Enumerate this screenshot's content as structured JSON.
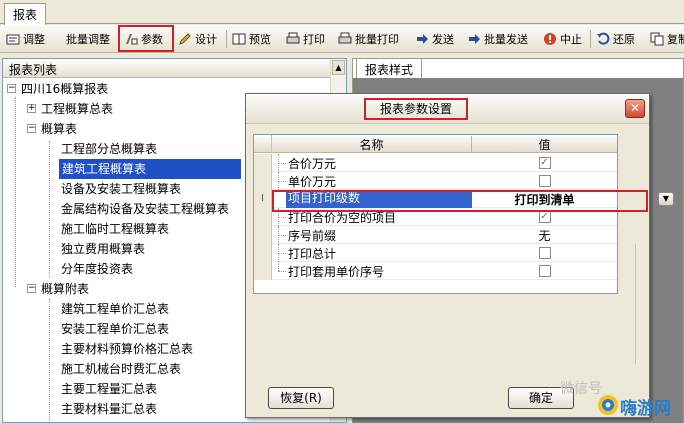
{
  "tab": {
    "label": "报表"
  },
  "toolbar": {
    "adjust": "调整",
    "batch_adjust": "批量调整",
    "params": "参数",
    "design": "设计",
    "preview": "预览",
    "print": "打印",
    "batch_print": "批量打印",
    "send": "发送",
    "batch_send": "批量发送",
    "abort": "中止",
    "restore": "还原",
    "copy": "复制"
  },
  "tree": {
    "header": "报表列表",
    "root": "四川16概算报表",
    "items": [
      "工程概算总表",
      "概算表",
      "工程部分总概算表",
      "建筑工程概算表",
      "设备及安装工程概算表",
      "金属结构设备及安装工程概算表",
      "施工临时工程概算表",
      "独立费用概算表",
      "分年度投资表",
      "概算附表",
      "建筑工程单价汇总表",
      "安装工程单价汇总表",
      "主要材料预算价格汇总表",
      "施工机械台时费汇总表",
      "主要工程量汇总表",
      "主要材料量汇总表"
    ]
  },
  "right_panel": {
    "tab": "报表样式"
  },
  "dialog": {
    "title": "报表参数设置",
    "col_name": "名称",
    "col_value": "值",
    "rows": [
      {
        "name": "合价万元",
        "value": "",
        "checked": true
      },
      {
        "name": "单价万元",
        "value": "",
        "checked": false
      },
      {
        "name": "项目打印级数",
        "value": "打印到清单",
        "checked": false
      },
      {
        "name": "打印合价为空的项目",
        "value": "",
        "checked": true
      },
      {
        "name": "序号前缀",
        "value": "无",
        "checked": false
      },
      {
        "name": "打印总计",
        "value": "",
        "checked": false
      },
      {
        "name": "打印套用单价序号",
        "value": "",
        "checked": false
      }
    ],
    "restore_button": "恢复(R)",
    "ok_button": "确定"
  },
  "watermark": {
    "text": "微信号",
    "logo": "嗨游网"
  },
  "colors": {
    "accent": "#d0202a",
    "selection": "#2050c8"
  }
}
